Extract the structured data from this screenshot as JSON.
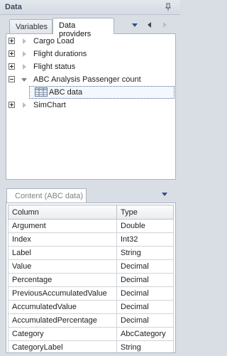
{
  "panel": {
    "title": "Data"
  },
  "tabs": [
    {
      "label": "Variables"
    },
    {
      "label": "Data providers"
    }
  ],
  "tree": {
    "items": [
      {
        "label": "Cargo Load",
        "expanded": false
      },
      {
        "label": "Flight durations",
        "expanded": false
      },
      {
        "label": "Flight status",
        "expanded": false
      },
      {
        "label": "ABC Analysis Passenger count",
        "expanded": true
      },
      {
        "label": "ABC data",
        "selected": true
      },
      {
        "label": "SimChart",
        "expanded": false
      }
    ]
  },
  "content": {
    "tab_label": "Content (ABC data)",
    "columns": [
      "Column",
      "Type"
    ],
    "rows": [
      [
        "Argument",
        "Double"
      ],
      [
        "Index",
        "Int32"
      ],
      [
        "Label",
        "String"
      ],
      [
        "Value",
        "Decimal"
      ],
      [
        "Percentage",
        "Decimal"
      ],
      [
        "PreviousAccumulatedValue",
        "Decimal"
      ],
      [
        "AccumulatedValue",
        "Decimal"
      ],
      [
        "AccumulatedPercentage",
        "Decimal"
      ],
      [
        "Category",
        "AbcCategory"
      ],
      [
        "CategoryLabel",
        "String"
      ]
    ]
  },
  "colors": {
    "accent": "#3b5998",
    "border": "#a9b3c0",
    "background": "#d9dee5"
  }
}
